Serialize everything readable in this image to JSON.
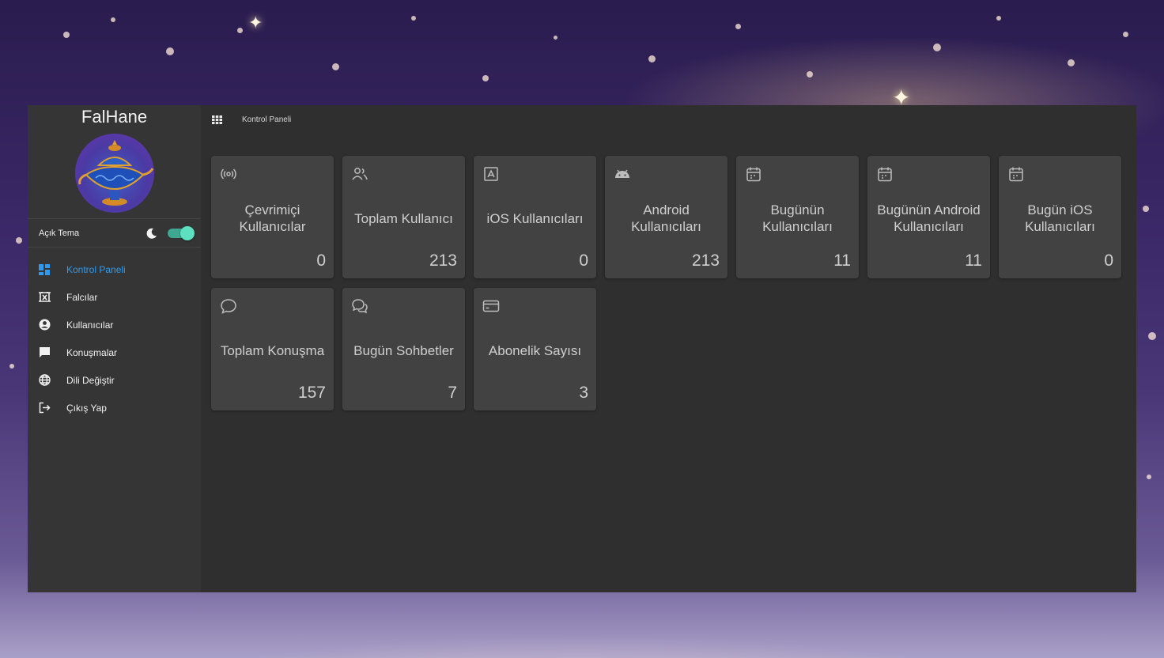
{
  "app": {
    "title": "FalHane"
  },
  "theme": {
    "label": "Açık Tema",
    "enabled": true
  },
  "nav": [
    {
      "label": "Kontrol Paneli",
      "icon": "dashboard-icon",
      "active": true
    },
    {
      "label": "Falcılar",
      "icon": "fortune-teller-icon",
      "active": false
    },
    {
      "label": "Kullanıcılar",
      "icon": "user-circle-icon",
      "active": false
    },
    {
      "label": "Konuşmalar",
      "icon": "chat-icon",
      "active": false
    },
    {
      "label": "Dili Değiştir",
      "icon": "globe-icon",
      "active": false
    },
    {
      "label": "Çıkış Yap",
      "icon": "logout-icon",
      "active": false
    }
  ],
  "breadcrumb": {
    "label": "Kontrol Paneli"
  },
  "cards": [
    {
      "title": "Çevrimiçi Kullanıcılar",
      "value": "0",
      "icon": "broadcast-icon"
    },
    {
      "title": "Toplam Kullanıcı",
      "value": "213",
      "icon": "users-icon"
    },
    {
      "title": "iOS Kullanıcıları",
      "value": "0",
      "icon": "app-store-icon"
    },
    {
      "title": "Android Kullanıcıları",
      "value": "213",
      "icon": "android-icon"
    },
    {
      "title": "Bugünün Kullanıcıları",
      "value": "11",
      "icon": "calendar-icon"
    },
    {
      "title": "Bugünün Android Kullanıcıları",
      "value": "11",
      "icon": "calendar-icon"
    },
    {
      "title": "Bugün iOS Kullanıcıları",
      "value": "0",
      "icon": "calendar-icon"
    },
    {
      "title": "Toplam Konuşma",
      "value": "157",
      "icon": "message-bubble-icon"
    },
    {
      "title": "Bugün Sohbetler",
      "value": "7",
      "icon": "messages-icon"
    },
    {
      "title": "Abonelik Sayısı",
      "value": "3",
      "icon": "credit-card-icon"
    }
  ],
  "colors": {
    "accent": "#2e9bf0",
    "toggle": "#5de0c0",
    "card": "#424242",
    "panel": "#2f2f2f",
    "sidebar": "#353535"
  }
}
